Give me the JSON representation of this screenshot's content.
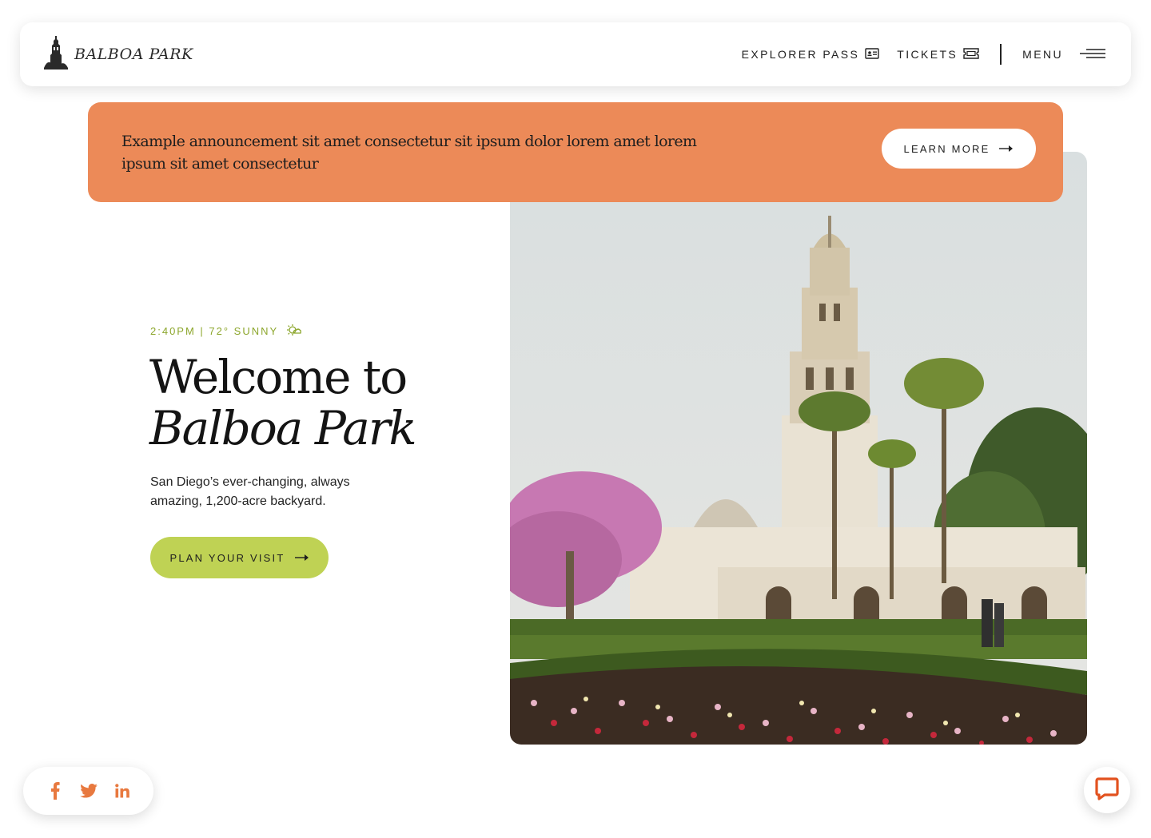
{
  "header": {
    "logo_text": "BALBOA PARK",
    "nav": {
      "explorer_pass": "EXPLORER PASS",
      "tickets": "TICKETS",
      "menu": "MENU"
    }
  },
  "announcement": {
    "text": "Example announcement sit amet consectetur sit ipsum dolor lorem amet lorem ipsum sit amet consectetur",
    "button_label": "LEARN MORE"
  },
  "hero": {
    "weather": "2:40PM | 72° SUNNY",
    "title_line1": "Welcome to",
    "title_line2": "Balboa Park",
    "subtitle": "San Diego’s ever-changing, always amazing, 1,200-acre backyard.",
    "cta_label": "PLAN YOUR VISIT"
  },
  "social": {
    "icons": [
      "facebook-icon",
      "twitter-icon",
      "linkedin-icon"
    ]
  },
  "colors": {
    "announcement_bg": "#ec8a58",
    "accent_green": "#bfd254",
    "weather_text": "#8ca62c",
    "social_icon": "#e8793f"
  }
}
